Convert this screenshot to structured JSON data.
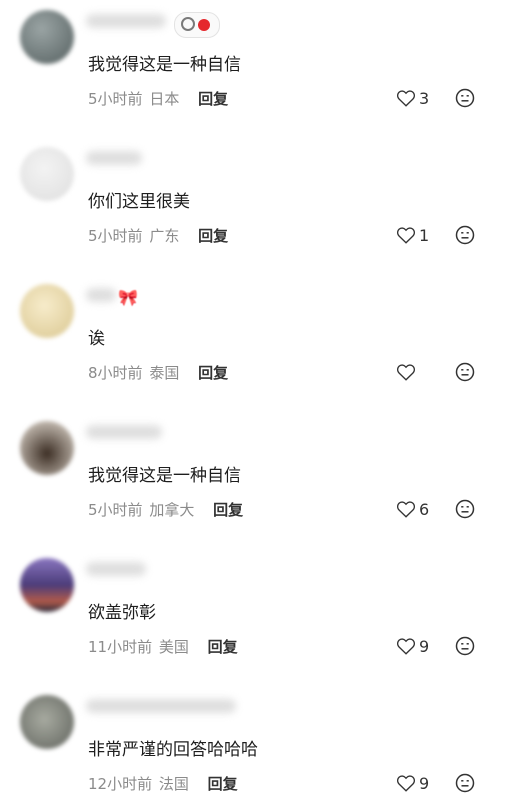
{
  "comments": [
    {
      "text": "我觉得这是一种自信",
      "time": "5小时前",
      "location": "日本",
      "reply": "回复",
      "likes": "3",
      "avatar_color": "#6f7878"
    },
    {
      "text": "你们这里很美",
      "time": "5小时前",
      "location": "广东",
      "reply": "回复",
      "likes": "1",
      "avatar_color": "#e9e9e9"
    },
    {
      "text": "诶",
      "time": "8小时前",
      "location": "泰国",
      "reply": "回复",
      "likes": "",
      "avatar_color": "#e8d7a6"
    },
    {
      "text": "我觉得这是一种自信",
      "time": "5小时前",
      "location": "加拿大",
      "reply": "回复",
      "likes": "6",
      "avatar_color": "#6b5a4c"
    },
    {
      "text": "欲盖弥彰",
      "time": "11小时前",
      "location": "美国",
      "reply": "回复",
      "likes": "9",
      "avatar_color": "#5c4a78"
    },
    {
      "text": "非常严谨的回答哈哈哈",
      "time": "12小时前",
      "location": "法国",
      "reply": "回复",
      "likes": "9",
      "avatar_color": "#7b7d77"
    }
  ],
  "icons": {
    "like": "heart-outline-icon",
    "dislike": "meh-face-icon"
  },
  "colors": {
    "meta": "#8b8b8b",
    "text": "#1e1e1e",
    "badge_red": "#e5282d"
  }
}
